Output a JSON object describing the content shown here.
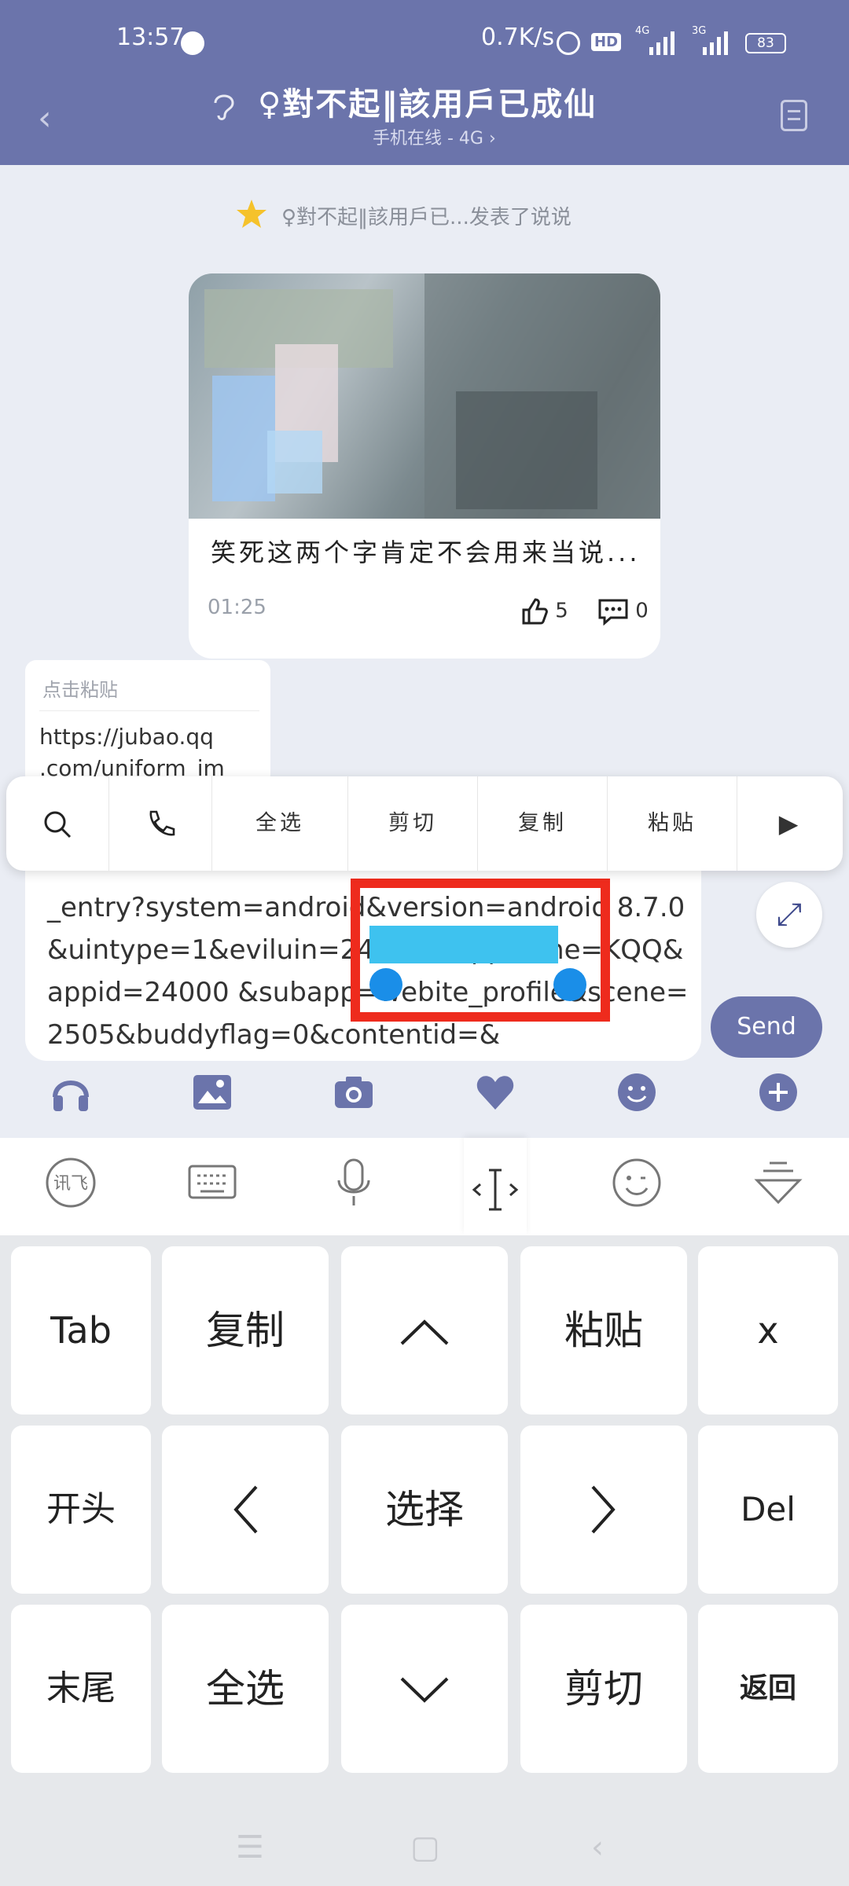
{
  "status_bar": {
    "time": "13:57",
    "net_speed": "0.7K/s",
    "hd": "HD",
    "net_4g": "4G",
    "net_3g": "3G",
    "battery": "83"
  },
  "header": {
    "title": "♀對不起‖該用戶已成仙",
    "subtitle": "手机在线 - 4G ›"
  },
  "notice": {
    "text": "♀對不起‖該用戶已...发表了说说"
  },
  "card": {
    "text": "笑死这两个字肯定不会用来当说...",
    "time": "01:25",
    "likes": "5",
    "comments": "0"
  },
  "paste_bubble": {
    "hint": "点击粘贴",
    "url": "https://jubao.qq\n.com/uniform_im"
  },
  "input": {
    "text": "_entry?system=android&version=android 8.7.0&uintype=1&eviluin=245 15&appname=KQQ&appid=24000 &subapp=webite_profile&scene=2505&buddyflag=0&contentid=&",
    "send_label": "Send"
  },
  "context_menu": {
    "items": [
      "全选",
      "剪切",
      "复制",
      "粘贴"
    ]
  },
  "keyboard": {
    "row1": [
      "Tab",
      "复制",
      "^",
      "粘贴",
      "x"
    ],
    "row2": [
      "开头",
      "<",
      "选择",
      ">",
      "Del"
    ],
    "row3": [
      "末尾",
      "全选",
      "v",
      "剪切",
      "返回"
    ]
  },
  "icons": {
    "toolbar": [
      "headphones-icon",
      "image-icon",
      "camera-icon",
      "heart-icon",
      "emoji-icon",
      "plus-icon"
    ],
    "keyboard_top": [
      "ifly-icon",
      "keyboard-icon",
      "mic-icon",
      "cursor-icon",
      "smile-icon",
      "collapse-icon"
    ]
  },
  "colors": {
    "header": "#6b74ab",
    "selection": "#3ec2ef",
    "annotation_box": "#ee2b1d"
  }
}
